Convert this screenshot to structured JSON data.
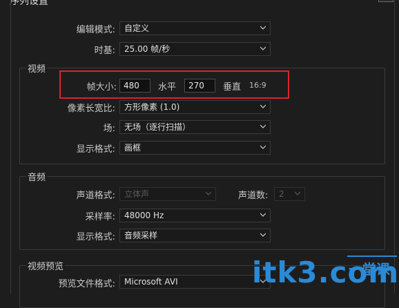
{
  "window": {
    "title": "序列设置"
  },
  "top": {
    "edit_mode_label": "编辑模式:",
    "edit_mode_value": "自定义",
    "timebase_label": "时基:",
    "timebase_value": "25.00  帧/秒"
  },
  "video": {
    "group_label": "视频",
    "frame_size_label": "帧大小:",
    "frame_width": "480",
    "horizontal_label": "水平",
    "frame_height": "270",
    "vertical_label": "垂直",
    "aspect": "16:9",
    "pixel_aspect_label": "像素长宽比:",
    "pixel_aspect_value": "方形像素 (1.0)",
    "field_label": "场:",
    "field_value": "无场（逐行扫描）",
    "display_format_label": "显示格式:",
    "display_format_value": "画框"
  },
  "audio": {
    "group_label": "音频",
    "channel_format_label": "声道格式:",
    "channel_format_value": "立体声",
    "channels_label": "声道数:",
    "channels_value": "2",
    "sample_rate_label": "采样率:",
    "sample_rate_value": "48000 Hz",
    "display_format_label": "显示格式:",
    "display_format_value": "音频采样"
  },
  "preview": {
    "group_label": "视频预览",
    "file_format_label": "预览文件格式:",
    "file_format_value": "Microsoft AVI"
  },
  "watermark": {
    "main": "itk3.com",
    "sub": "一堂课"
  },
  "colors": {
    "highlight": "#d8262a",
    "watermark": "#2b8ad6"
  }
}
